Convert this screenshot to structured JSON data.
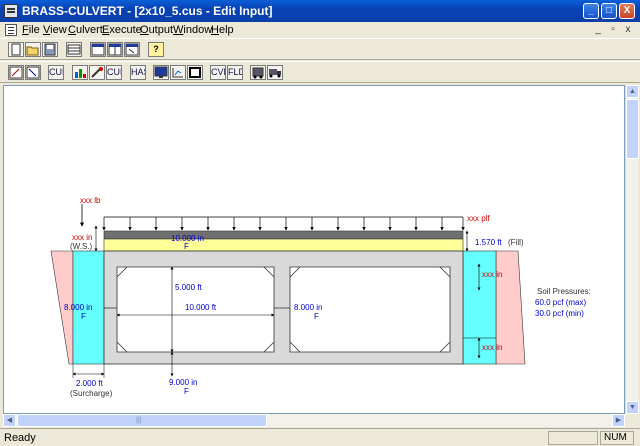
{
  "window": {
    "title": "BRASS-CULVERT - [2x10_5.cus - Edit Input]",
    "minimize_glyph": "_",
    "maximize_glyph": "□",
    "close_glyph": "X"
  },
  "menu": {
    "items": [
      "File",
      "View",
      "Culvert",
      "Execute",
      "Output",
      "Window",
      "Help"
    ],
    "mdi_minimize": "_",
    "mdi_restore": "▫",
    "mdi_close": "x"
  },
  "toolbar1": {
    "icons": [
      "new-file-icon",
      "open-folder-icon",
      "save-disk-icon",
      "data-grid-icon",
      "window-list-icon",
      "window-grid-icon",
      "window-resize-icon",
      "help-icon"
    ],
    "help_glyph": "?"
  },
  "toolbar2": {
    "icons": [
      "edit-a-icon",
      "edit-b-icon",
      "cul-icon",
      "chart-icon",
      "gauge-icon",
      "cul-output-icon",
      "has-icon",
      "monitor-icon",
      "grid-tool-icon",
      "box-tool-icon",
      "cvp-icon",
      "fld-icon",
      "truck-front-icon",
      "truck-side-icon"
    ],
    "labels": {
      "cul": "CUL",
      "has": "HAS",
      "cvp": "CVP",
      "fld": "FLD"
    }
  },
  "drawing": {
    "load_point": "xxx lb",
    "load_dist": "xxx plf",
    "ws_depth": "xxx in",
    "ws_label": "(W.S.)",
    "slab_thickness": "10.000 in",
    "slab_code": "F",
    "fill_height": "1.570 ft",
    "fill_label": "(Fill)",
    "cell_height": "5.000 ft",
    "cell_width": "10.000 ft",
    "wall_thickness": "8.000 in",
    "wall_code": "F",
    "interior_wall": "8.000 in",
    "interior_code": "F",
    "bottom_slab": "9.000 in",
    "bottom_code": "F",
    "surcharge_width": "2.000 ft",
    "surcharge_label": "(Surcharge)",
    "side_dim_top": "xxx in",
    "side_dim_bottom": "xxx in",
    "soil_title": "Soil Pressures:",
    "soil_max": "60.0 pcf  (max)",
    "soil_min": "30.0 pcf  (min)"
  },
  "colors": {
    "title_bar": "#0a4fd0",
    "pavement": "#707070",
    "fill": "#ffff99",
    "water": "#66ffff",
    "soil": "#ffcccc",
    "concrete": "#d9d9d9",
    "dim_red": "#cc0000",
    "dim_blue": "#0000cc"
  },
  "status": {
    "text": "Ready",
    "num": "NUM"
  }
}
